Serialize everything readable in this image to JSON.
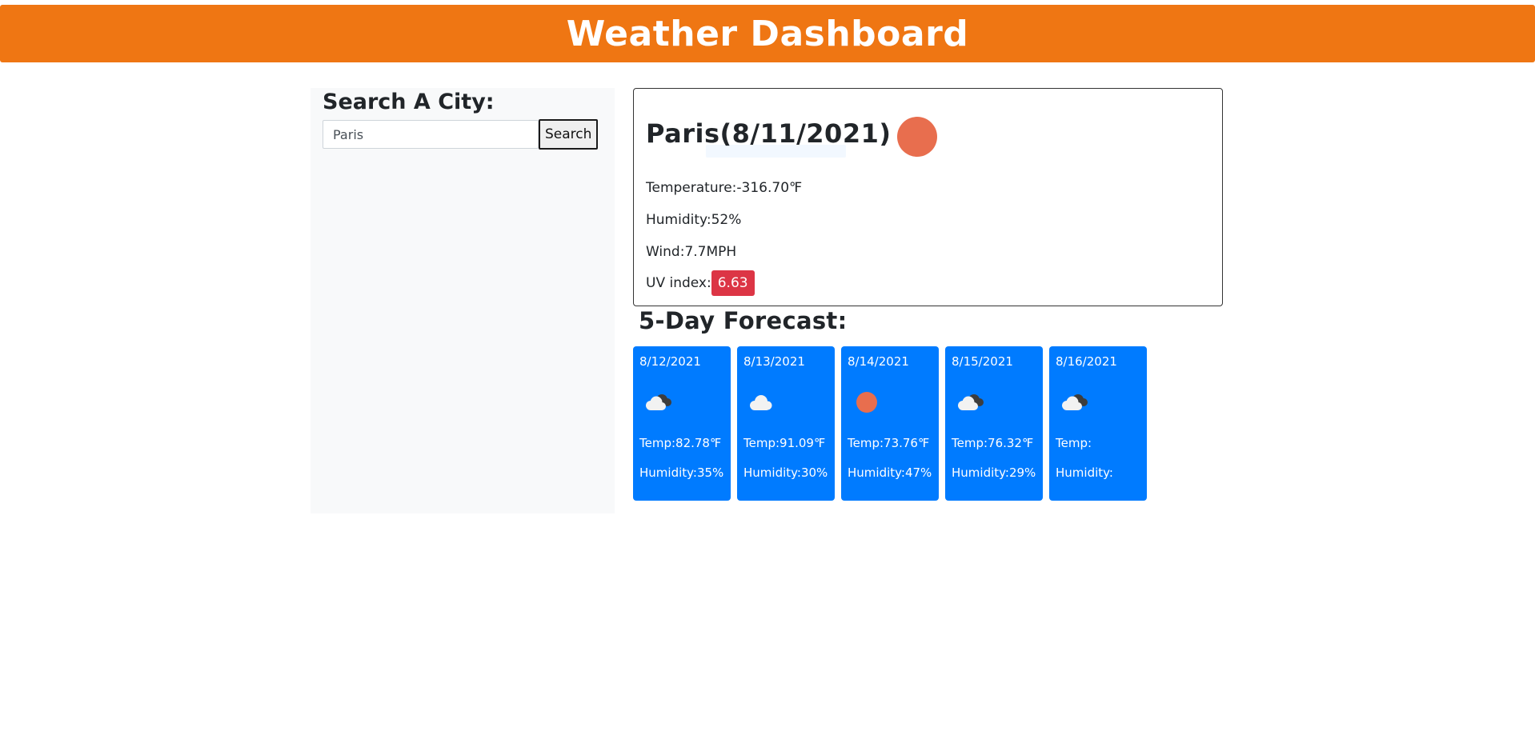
{
  "header": {
    "title": "Weather Dashboard"
  },
  "search": {
    "heading": "Search A City:",
    "input_value": "Paris",
    "button_label": "Search"
  },
  "current": {
    "title": "Paris(8/11/2021)",
    "icon": "clear-sun-icon",
    "temperature": "Temperature:-316.70℉",
    "humidity": "Humidity:52%",
    "wind": "Wind:7.7MPH",
    "uv_label": "UV index:",
    "uv_value": "6.63",
    "uv_color": "#dc3545"
  },
  "forecast": {
    "heading": "5-Day Forecast:",
    "card_color": "#007bff",
    "days": [
      {
        "date": "8/12/2021",
        "icon": "broken-clouds-icon",
        "temp": "Temp:82.78℉",
        "humidity": "Humidity:35%"
      },
      {
        "date": "8/13/2021",
        "icon": "cloud-icon",
        "temp": "Temp:91.09℉",
        "humidity": "Humidity:30%"
      },
      {
        "date": "8/14/2021",
        "icon": "clear-sun-icon",
        "temp": "Temp:73.76℉",
        "humidity": "Humidity:47%"
      },
      {
        "date": "8/15/2021",
        "icon": "broken-clouds-icon",
        "temp": "Temp:76.32℉",
        "humidity": "Humidity:29%"
      },
      {
        "date": "8/16/2021",
        "icon": "broken-clouds-icon",
        "temp": "Temp:",
        "humidity": "Humidity:"
      }
    ]
  },
  "colors": {
    "header": "#ef7613",
    "sun": "#e86e4e",
    "sidebar": "#f8f9fa"
  }
}
